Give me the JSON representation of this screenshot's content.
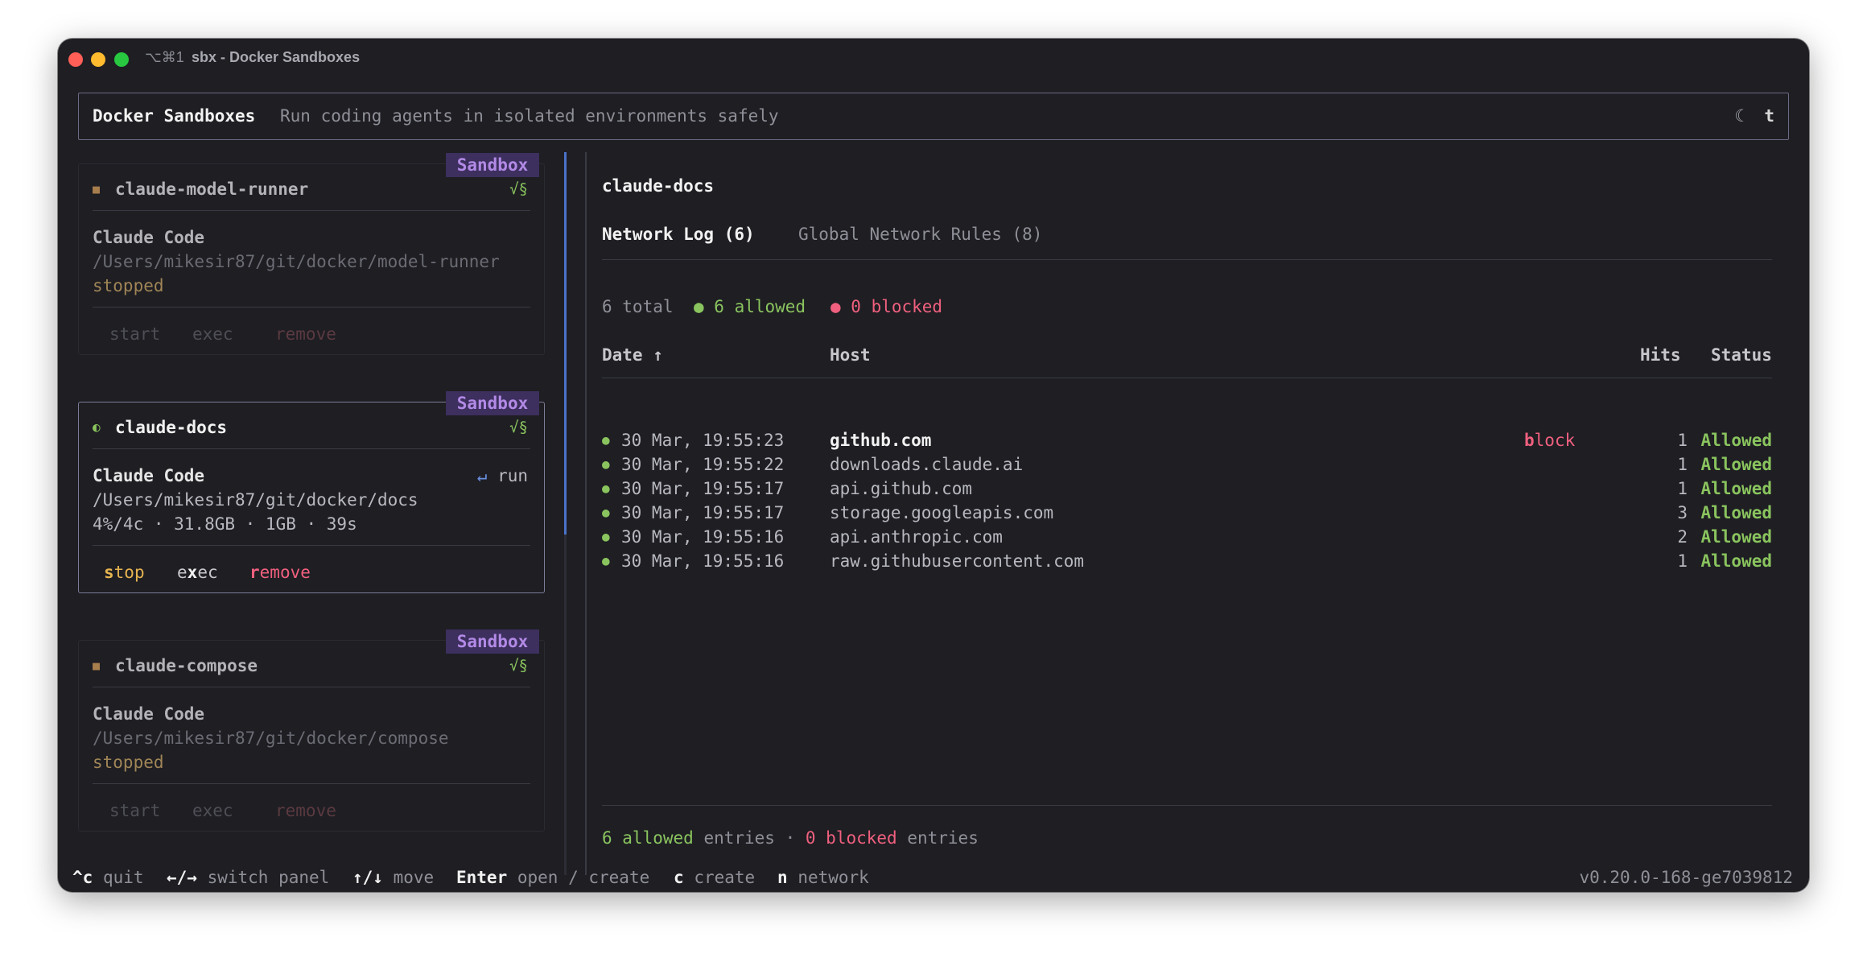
{
  "window": {
    "shortcut": "⌥⌘1",
    "title": "sbx - Docker Sandboxes"
  },
  "header": {
    "title": "Docker Sandboxes",
    "subtitle": "Run coding agents in isolated environments safely",
    "theme_icon": "☾",
    "theme_key": "t"
  },
  "sandboxes": [
    {
      "badge": "Sandbox",
      "name": "claude-model-runner",
      "flag": "√§",
      "agent": "Claude Code",
      "path": "/Users/mikesir87/git/docker/model-runner",
      "state": "stopped",
      "actions": [
        "start",
        "exec",
        "remove"
      ],
      "status_icon": "■"
    },
    {
      "badge": "Sandbox",
      "name": "claude-docs",
      "flag": "√§",
      "agent": "Claude Code",
      "run_hint_arrow": "↵",
      "run_hint": "run",
      "path": "/Users/mikesir87/git/docker/docs",
      "stats": "4%/4c · 31.8GB · 1GB · 39s",
      "actions": [
        {
          "key": "s",
          "rest": "top"
        },
        {
          "pre": "e",
          "key": "x",
          "rest": "ec"
        },
        {
          "key": "r",
          "rest": "emove"
        }
      ],
      "status_icon": "◐"
    },
    {
      "badge": "Sandbox",
      "name": "claude-compose",
      "flag": "√§",
      "agent": "Claude Code",
      "path": "/Users/mikesir87/git/docker/compose",
      "state": "stopped",
      "actions": [
        "start",
        "exec",
        "remove"
      ],
      "status_icon": "■"
    }
  ],
  "detail": {
    "title": "claude-docs",
    "tabs": [
      "Network Log (6)",
      "Global Network Rules (8)"
    ],
    "summary": {
      "total": "6 total",
      "allowed": "● 6 allowed",
      "blocked": "● 0 blocked"
    },
    "columns": {
      "date": "Date ↑",
      "host": "Host",
      "hits": "Hits",
      "status": "Status"
    },
    "rows": [
      {
        "dot": "●",
        "date": "30 Mar, 19:55:23",
        "host": "github.com",
        "hits": "1",
        "status": "Allowed"
      },
      {
        "dot": "●",
        "date": "30 Mar, 19:55:22",
        "host": "downloads.claude.ai",
        "hits": "1",
        "status": "Allowed"
      },
      {
        "dot": "●",
        "date": "30 Mar, 19:55:17",
        "host": "api.github.com",
        "hits": "1",
        "status": "Allowed"
      },
      {
        "dot": "●",
        "date": "30 Mar, 19:55:17",
        "host": "storage.googleapis.com",
        "hits": "3",
        "status": "Allowed"
      },
      {
        "dot": "●",
        "date": "30 Mar, 19:55:16",
        "host": "api.anthropic.com",
        "hits": "2",
        "status": "Allowed"
      },
      {
        "dot": "●",
        "date": "30 Mar, 19:55:16",
        "host": "raw.githubusercontent.com",
        "hits": "1",
        "status": "Allowed"
      }
    ],
    "block_action": {
      "key": "b",
      "rest": "lock"
    },
    "footer": {
      "allowed": "6 allowed",
      "allowed_suffix": " entries",
      "sep": " · ",
      "blocked": "0 blocked",
      "blocked_suffix": " entries"
    }
  },
  "statusbar": {
    "items": [
      {
        "key": "^c",
        "desc": "quit"
      },
      {
        "key": "←/→",
        "desc": "switch panel"
      },
      {
        "key": "↑/↓",
        "desc": "move"
      },
      {
        "key": "Enter",
        "desc": "open / create"
      },
      {
        "key": "c",
        "desc": "create"
      },
      {
        "key": "n",
        "desc": "network"
      }
    ],
    "version": "v0.20.0-168-ge7039812"
  },
  "colors": {
    "background": "#1e1e23",
    "accent_purple": "#b28ae6",
    "badge_bg": "#3d2f5e",
    "allowed_green": "#8ac45e",
    "blocked_red": "#f0607e",
    "stop_yellow": "#e6b450"
  }
}
